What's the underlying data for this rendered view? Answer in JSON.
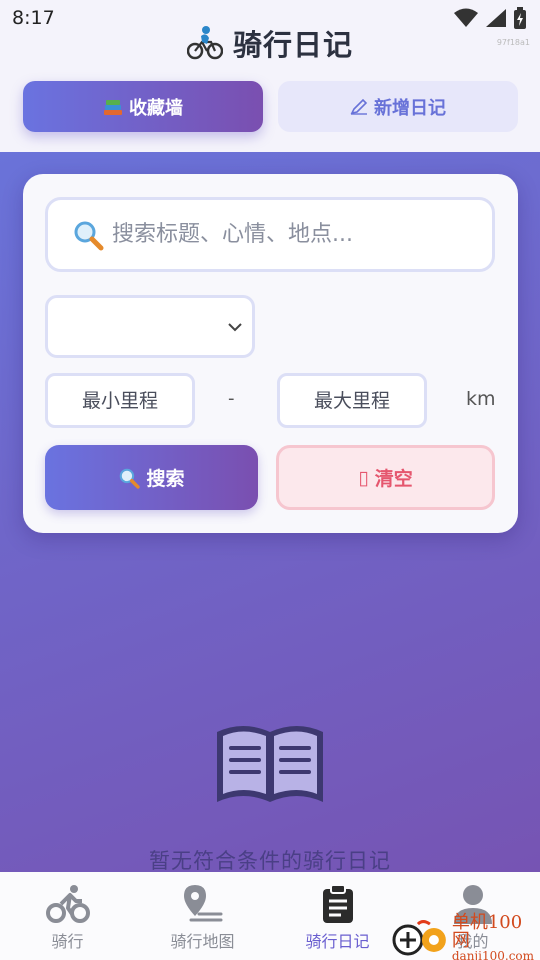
{
  "status_bar": {
    "time": "8:17"
  },
  "header": {
    "title": "骑行日记",
    "tag": "97f18a1",
    "icon": "cyclist-icon"
  },
  "tabs": [
    {
      "label": "收藏墙",
      "icon": "books-icon",
      "active": true
    },
    {
      "label": "新增日记",
      "icon": "pencil-icon",
      "active": false
    }
  ],
  "search": {
    "placeholder": "搜索标题、心情、地点...",
    "value": "",
    "select_value": "",
    "min_placeholder": "最小里程",
    "max_placeholder": "最大里程",
    "separator": "-",
    "unit": "km",
    "search_label": "搜索",
    "clear_label": "清空",
    "clear_icon_glyph": "▯"
  },
  "empty": {
    "text": "暂无符合条件的骑行日记",
    "icon": "open-book-icon"
  },
  "nav": [
    {
      "label": "骑行",
      "icon": "bicycle-icon",
      "active": false
    },
    {
      "label": "骑行地图",
      "icon": "map-pin-icon",
      "active": false
    },
    {
      "label": "骑行日记",
      "icon": "clipboard-icon",
      "active": true
    },
    {
      "label": "我的",
      "icon": "user-icon",
      "active": false
    }
  ],
  "watermark": {
    "cn": "单机100网",
    "url": "danji100.com"
  },
  "colors": {
    "accent_start": "#6a73e0",
    "accent_end": "#7a4fb0",
    "clear": "#e5566e",
    "nav_active": "#6a5fd0"
  }
}
